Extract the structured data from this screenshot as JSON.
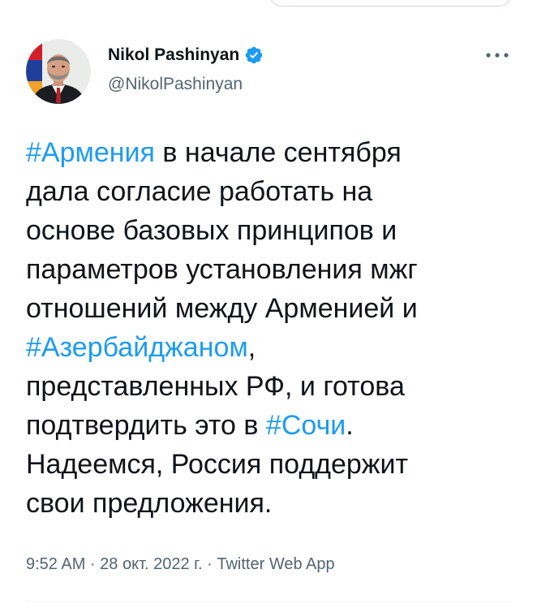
{
  "tweet": {
    "author": {
      "display_name": "Nikol Pashinyan",
      "handle": "@NikolPashinyan",
      "verified": true
    },
    "lines": [
      [
        {
          "text": "#Армения",
          "tag": true
        },
        {
          "text": " в начале сентября",
          "tag": false
        }
      ],
      [
        {
          "text": "дала согласие работать на",
          "tag": false
        }
      ],
      [
        {
          "text": "основе базовых принципов и",
          "tag": false
        }
      ],
      [
        {
          "text": "параметров установления мжг",
          "tag": false
        }
      ],
      [
        {
          "text": "отношений между Арменией и",
          "tag": false
        }
      ],
      [
        {
          "text": "#Азербайджаном",
          "tag": true
        },
        {
          "text": ",",
          "tag": false
        }
      ],
      [
        {
          "text": "представленных РФ, и готова",
          "tag": false
        }
      ],
      [
        {
          "text": "подтвердить это в ",
          "tag": false
        },
        {
          "text": "#Сочи",
          "tag": true
        },
        {
          "text": ".",
          "tag": false
        }
      ],
      [
        {
          "text": "Надеемся, Россия поддержит",
          "tag": false
        }
      ],
      [
        {
          "text": "свои предложения.",
          "tag": false
        }
      ]
    ],
    "meta": {
      "time": "9:52 AM",
      "sep1": " · ",
      "date": "28 окт. 2022 г.",
      "sep2": " · ",
      "source": "Twitter Web App"
    }
  },
  "colors": {
    "hashtag": "#1d9bf0",
    "text": "#0f1419",
    "secondary": "#536471",
    "verified": "#1d9bf0"
  },
  "icons": {
    "verified": "verified-badge-icon",
    "more": "more-options-icon"
  }
}
